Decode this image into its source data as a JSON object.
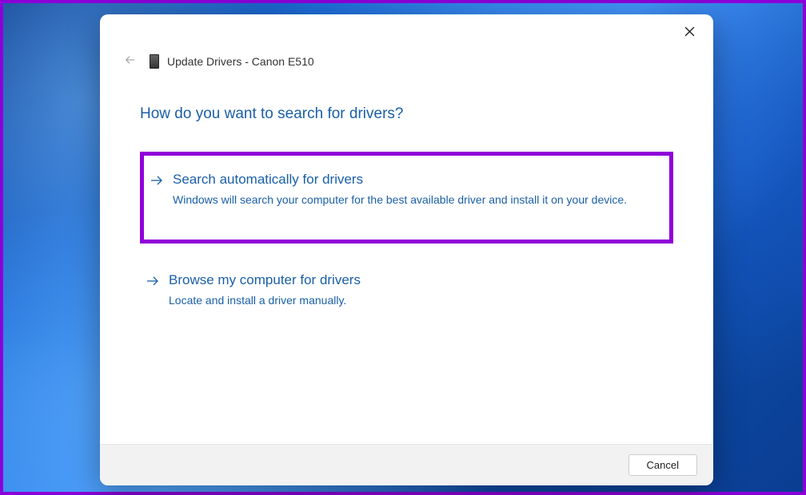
{
  "dialog": {
    "title": "Update Drivers - Canon E510",
    "heading": "How do you want to search for drivers?"
  },
  "options": {
    "auto": {
      "title": "Search automatically for drivers",
      "desc": "Windows will search your computer for the best available driver and install it on your device."
    },
    "browse": {
      "title": "Browse my computer for drivers",
      "desc": "Locate and install a driver manually."
    }
  },
  "footer": {
    "cancel": "Cancel"
  }
}
